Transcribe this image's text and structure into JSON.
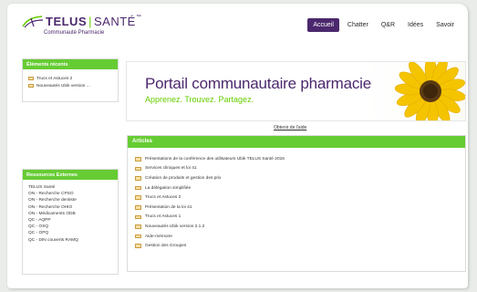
{
  "header": {
    "logo_brand": "TELUS",
    "logo_separator": "|",
    "logo_product": "SANTÉ",
    "logo_tm": "™",
    "logo_subtitle": "Communauté Pharmacie"
  },
  "nav": [
    {
      "label": "Accueil",
      "active": true
    },
    {
      "label": "Chatter",
      "active": false
    },
    {
      "label": "Q&R",
      "active": false
    },
    {
      "label": "Idées",
      "active": false
    },
    {
      "label": "Savoir",
      "active": false
    }
  ],
  "recent": {
    "title": "Éléments récents",
    "items": [
      "Trucs et Astuces 2",
      "Nouveautés Ubik version ..."
    ]
  },
  "resources": {
    "title": "Ressources Externes",
    "items": [
      "TELUS Santé",
      "ON - Recherche CPSO",
      "ON - Recherche dentiste",
      "ON - Recherche OHIO",
      "ON - Médicaments ODB",
      "QC - AQPP",
      "QC - OSQ",
      "QC - OPQ",
      "QC - DIN couverts RAMQ"
    ]
  },
  "banner": {
    "title": "Portail communautaire pharmacie",
    "subtitle": "Apprenez. Trouvez. Partagez."
  },
  "feedback_link": "Obtenir de l'aide",
  "articles": {
    "title": "Articles",
    "items": [
      "Présentations de la conférence des utilisateurs Ubik TELUS Santé 2016",
      "Services cliniques et loi 41",
      "Création de produits et gestion des prix",
      "La délégation simplifiée",
      "Trucs et Astuces 2",
      "Présentation de la loi 41",
      "Trucs et Astuces 1",
      "Nouveautés Ubik version 2.1.2",
      "Aide-mémoire",
      "Gestion des Groupes"
    ]
  },
  "colors": {
    "brand_purple": "#4b286d",
    "accent_green": "#66cc33"
  }
}
